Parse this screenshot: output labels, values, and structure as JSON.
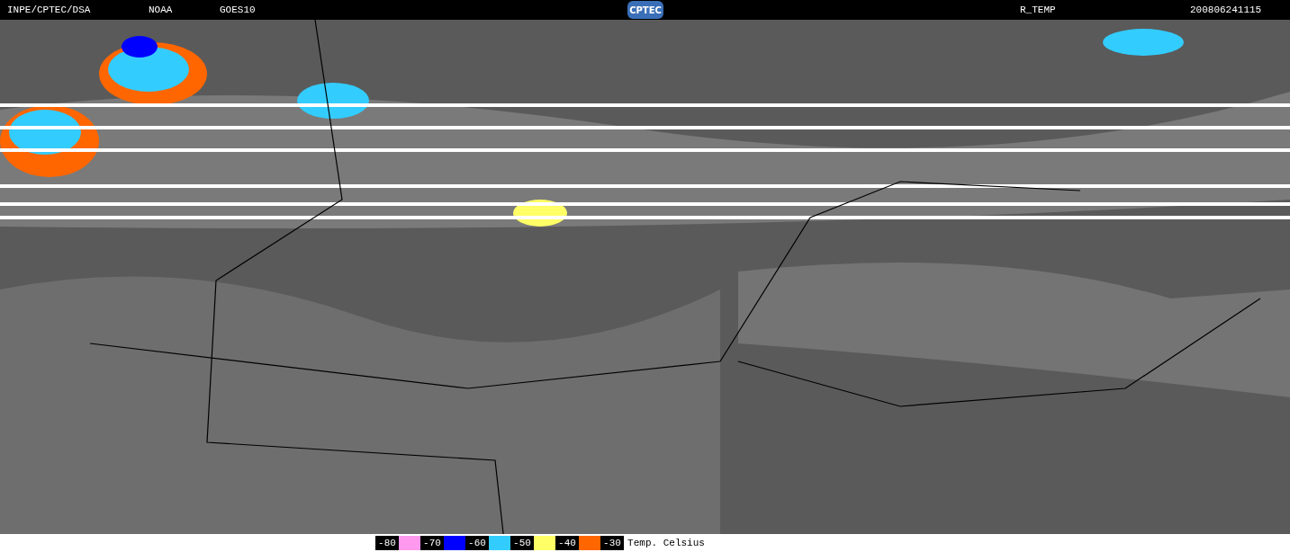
{
  "header": {
    "source": "INPE/CPTEC/DSA",
    "agency": "NOAA",
    "satellite": "GOES10",
    "logo": "CPTEC",
    "product": "R_TEMP",
    "timestamp": "200806241115"
  },
  "legend": {
    "items": [
      {
        "label": "-80",
        "color": "#ff99ee"
      },
      {
        "label": "-70",
        "color": "#0000ff"
      },
      {
        "label": "-60",
        "color": "#33ccff"
      },
      {
        "label": "-50",
        "color": "#ffff66"
      },
      {
        "label": "-40",
        "color": "#ff6600"
      },
      {
        "label": "-30"
      }
    ],
    "unit": "Temp. Celsius"
  }
}
